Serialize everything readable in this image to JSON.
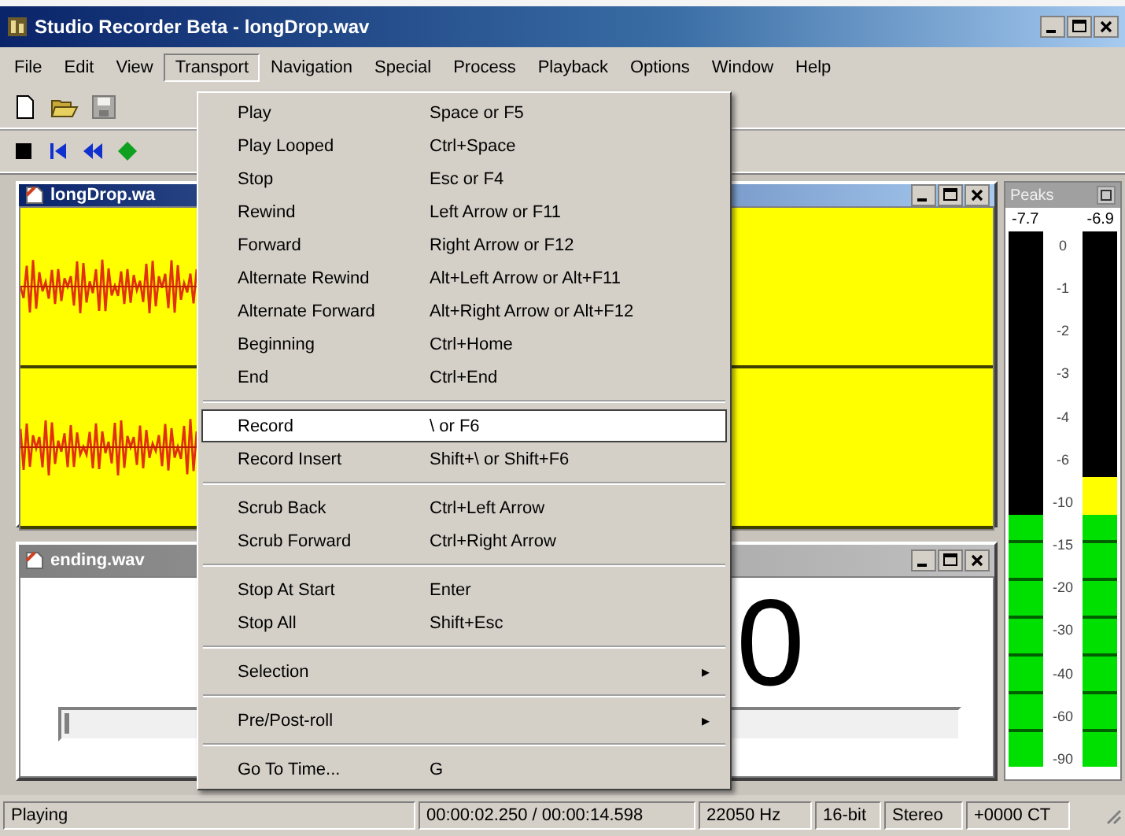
{
  "window": {
    "title": "Studio Recorder Beta - longDrop.wav"
  },
  "menubar": [
    {
      "label": "File",
      "selected": false
    },
    {
      "label": "Edit",
      "selected": false
    },
    {
      "label": "View",
      "selected": false
    },
    {
      "label": "Transport",
      "selected": true
    },
    {
      "label": "Navigation",
      "selected": false
    },
    {
      "label": "Special",
      "selected": false
    },
    {
      "label": "Process",
      "selected": false
    },
    {
      "label": "Playback",
      "selected": false
    },
    {
      "label": "Options",
      "selected": false
    },
    {
      "label": "Window",
      "selected": false
    },
    {
      "label": "Help",
      "selected": false
    }
  ],
  "documents": [
    {
      "kind": "waveform",
      "title": "longDrop.wa",
      "active": true
    },
    {
      "kind": "counter",
      "title": "ending.wav",
      "active": false,
      "counter": "0",
      "position": {
        "level": 0
      }
    }
  ],
  "meters": {
    "title": "Peaks",
    "scale": [
      "0",
      "-1",
      "-2",
      "-3",
      "-4",
      "-6",
      "-10",
      "-15",
      "-20",
      "-30",
      "-40",
      "-60",
      "-90"
    ],
    "channels": [
      {
        "reading": "-7.7"
      },
      {
        "reading": "-6.9"
      }
    ]
  },
  "menu": {
    "items": [
      {
        "kind": "item",
        "label": "Play",
        "shortcut": "Space or F5",
        "selected": false
      },
      {
        "kind": "item",
        "label": "Play Looped",
        "shortcut": "Ctrl+Space",
        "selected": false
      },
      {
        "kind": "item",
        "label": "Stop",
        "shortcut": "Esc or F4",
        "selected": false
      },
      {
        "kind": "item",
        "label": "Rewind",
        "shortcut": "Left Arrow or F11",
        "selected": false
      },
      {
        "kind": "item",
        "label": "Forward",
        "shortcut": "Right Arrow or F12",
        "selected": false
      },
      {
        "kind": "item",
        "label": "Alternate Rewind",
        "shortcut": "Alt+Left Arrow or Alt+F11",
        "selected": false
      },
      {
        "kind": "item",
        "label": "Alternate Forward",
        "shortcut": "Alt+Right Arrow or Alt+F12",
        "selected": false
      },
      {
        "kind": "item",
        "label": "Beginning",
        "shortcut": "Ctrl+Home",
        "selected": false
      },
      {
        "kind": "item",
        "label": "End",
        "shortcut": "Ctrl+End",
        "selected": false
      },
      {
        "kind": "separator"
      },
      {
        "kind": "item",
        "label": "Record",
        "shortcut": "\\ or F6",
        "selected": true
      },
      {
        "kind": "item",
        "label": "Record Insert",
        "shortcut": "Shift+\\ or Shift+F6",
        "selected": false
      },
      {
        "kind": "separator"
      },
      {
        "kind": "item",
        "label": "Scrub Back",
        "shortcut": "Ctrl+Left Arrow",
        "selected": false
      },
      {
        "kind": "item",
        "label": "Scrub Forward",
        "shortcut": "Ctrl+Right Arrow",
        "selected": false
      },
      {
        "kind": "separator"
      },
      {
        "kind": "item",
        "label": "Stop At Start",
        "shortcut": "Enter",
        "selected": false
      },
      {
        "kind": "item",
        "label": "Stop All",
        "shortcut": "Shift+Esc",
        "selected": false
      },
      {
        "kind": "separator"
      },
      {
        "kind": "submenu",
        "label": "Selection",
        "arrow": "▸",
        "selected": false
      },
      {
        "kind": "separator"
      },
      {
        "kind": "submenu",
        "label": "Pre/Post-roll",
        "arrow": "▸",
        "selected": false
      },
      {
        "kind": "separator"
      },
      {
        "kind": "item",
        "label": "Go To Time...",
        "shortcut": "G",
        "selected": false
      }
    ]
  },
  "status_bar": [
    "Playing",
    "00:00:02.250 / 00:00:14.598",
    "22050 Hz",
    "16-bit",
    "Stereo",
    "+0000 CT"
  ]
}
